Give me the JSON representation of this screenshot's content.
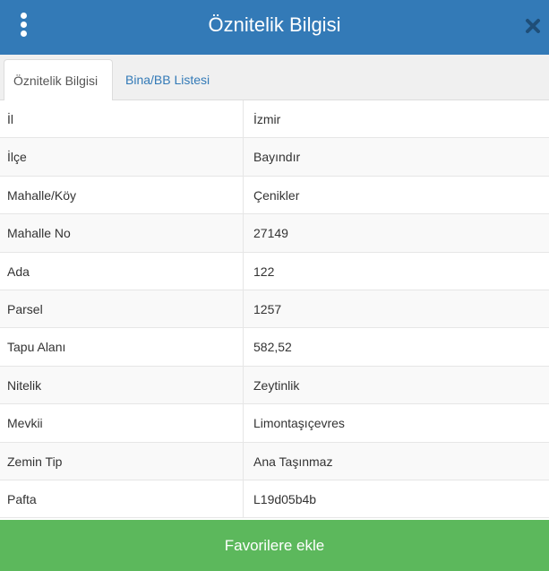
{
  "header": {
    "title": "Öznitelik Bilgisi",
    "menu_icon": "vertical-dots-icon",
    "close_icon": "close-icon"
  },
  "tabs": [
    {
      "label": "Öznitelik Bilgisi",
      "active": true
    },
    {
      "label": "Bina/BB Listesi",
      "active": false
    }
  ],
  "attributes": [
    {
      "key": "İl",
      "value": "İzmir"
    },
    {
      "key": "İlçe",
      "value": "Bayındır"
    },
    {
      "key": "Mahalle/Köy",
      "value": "Çenikler"
    },
    {
      "key": "Mahalle No",
      "value": "27149"
    },
    {
      "key": "Ada",
      "value": "122"
    },
    {
      "key": "Parsel",
      "value": "1257"
    },
    {
      "key": "Tapu Alanı",
      "value": "582,52"
    },
    {
      "key": "Nitelik",
      "value": "Zeytinlik"
    },
    {
      "key": "Mevkii",
      "value": "Limontaşıçevres"
    },
    {
      "key": "Zemin Tip",
      "value": "Ana Taşınmaz"
    },
    {
      "key": "Pafta",
      "value": "L19d05b4b"
    }
  ],
  "footer": {
    "favorite_label": "Favorilere ekle"
  },
  "colors": {
    "header": "#337ab7",
    "tab_link": "#337ab7",
    "favorite_button": "#5cb85c"
  }
}
